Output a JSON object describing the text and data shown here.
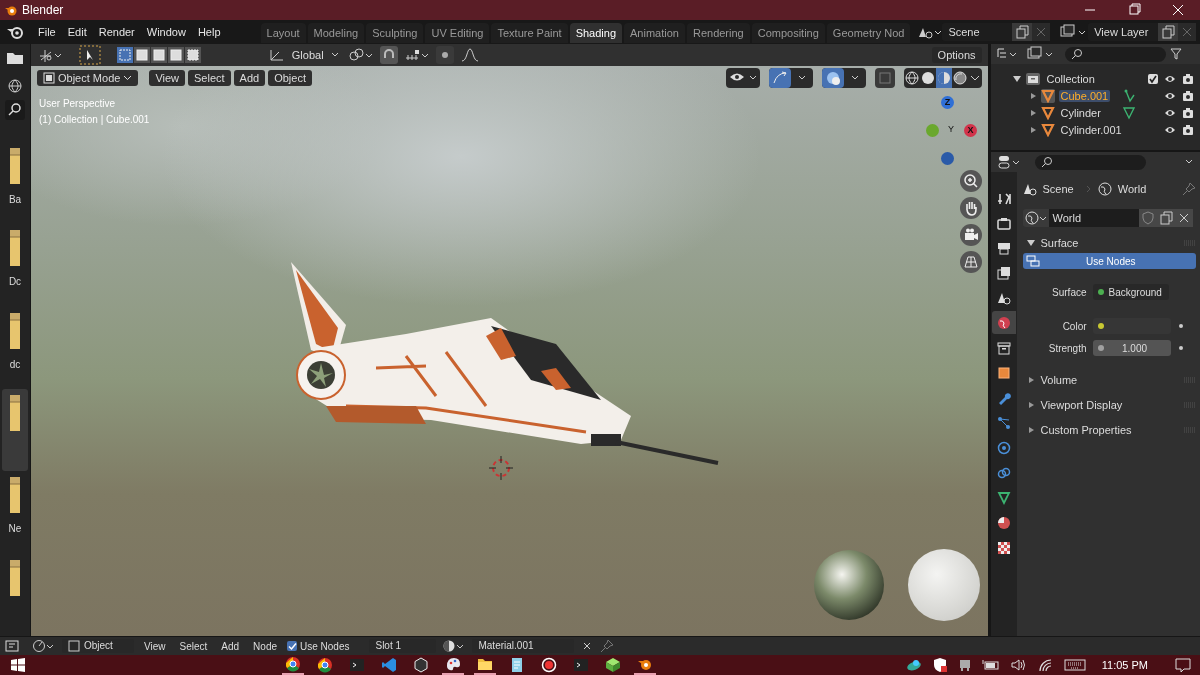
{
  "window": {
    "title": "Blender"
  },
  "menu": [
    "File",
    "Edit",
    "Render",
    "Window",
    "Help"
  ],
  "workspaces": [
    {
      "label": "Layout",
      "selected": false
    },
    {
      "label": "Modeling",
      "selected": false
    },
    {
      "label": "Sculpting",
      "selected": false
    },
    {
      "label": "UV Editing",
      "selected": false
    },
    {
      "label": "Texture Paint",
      "selected": false
    },
    {
      "label": "Shading",
      "selected": true
    },
    {
      "label": "Animation",
      "selected": false
    },
    {
      "label": "Rendering",
      "selected": false
    },
    {
      "label": "Compositing",
      "selected": false
    },
    {
      "label": "Geometry Nod",
      "selected": false
    }
  ],
  "scene": "Scene",
  "view_layer": "View Layer",
  "tool_header": {
    "select_modes": [
      {
        "selected": true
      },
      {
        "selected": false
      },
      {
        "selected": false
      },
      {
        "selected": false
      },
      {
        "selected": false
      }
    ],
    "orientation": "Global",
    "options": "Options"
  },
  "file_browser": {
    "items": [
      {
        "label": "Ba",
        "selected": false
      },
      {
        "label": "Dc",
        "selected": false
      },
      {
        "label": "dc",
        "selected": false
      },
      {
        "selected": true
      },
      {
        "label": "Ne",
        "selected": false
      },
      {
        "selected": false
      }
    ]
  },
  "viewport": {
    "mode": "Object Mode",
    "menus": [
      "View",
      "Select",
      "Add",
      "Object"
    ],
    "info": [
      "User Perspective",
      "(1) Collection | Cube.001"
    ],
    "shading": [
      {
        "kind": "wireframe",
        "selected": false
      },
      {
        "kind": "solid",
        "selected": false
      },
      {
        "kind": "material",
        "selected": true
      },
      {
        "kind": "rendered",
        "selected": false
      }
    ],
    "gizmo": {
      "x": "X",
      "y": "Y",
      "z": "Z"
    }
  },
  "outliner": {
    "items": [
      {
        "name": "Collection",
        "kind": "collection",
        "expanded": true,
        "checked": true,
        "children": [
          {
            "name": "Cube.001",
            "kind": "mesh",
            "expanded": false,
            "selected": true
          },
          {
            "name": "Cylinder",
            "kind": "mesh",
            "expanded": false,
            "selected": false
          },
          {
            "name": "Cylinder.001",
            "kind": "mesh",
            "expanded": false,
            "selected": false
          }
        ]
      }
    ]
  },
  "properties": {
    "tabs": [
      {
        "kind": "tool",
        "selected": false
      },
      {
        "kind": "render",
        "selected": false
      },
      {
        "kind": "output",
        "selected": false
      },
      {
        "kind": "view_layer",
        "selected": false
      },
      {
        "kind": "scene",
        "selected": false
      },
      {
        "kind": "world",
        "selected": true
      },
      {
        "kind": "collection",
        "selected": false
      },
      {
        "kind": "object",
        "selected": false
      },
      {
        "kind": "modifier",
        "selected": false
      },
      {
        "kind": "particles",
        "selected": false
      },
      {
        "kind": "physics",
        "selected": false
      },
      {
        "kind": "constraints",
        "selected": false
      },
      {
        "kind": "data",
        "selected": false
      },
      {
        "kind": "material",
        "selected": false
      },
      {
        "kind": "texture",
        "selected": false
      }
    ],
    "breadcrumb": [
      "Scene",
      "World"
    ],
    "world_name": "World",
    "panels": [
      {
        "title": "Surface",
        "expanded": true,
        "button": "Use Nodes",
        "rows": [
          {
            "label": "Surface",
            "value": "Background",
            "color": "#4caf50",
            "kind": "link"
          },
          {
            "label": "Color",
            "color": "#c8c832",
            "kind": "color"
          },
          {
            "label": "Strength",
            "value": "1.000",
            "color": "#a0a0a0",
            "kind": "number"
          }
        ]
      },
      {
        "title": "Volume",
        "expanded": false
      },
      {
        "title": "Viewport Display",
        "expanded": false
      },
      {
        "title": "Custom Properties",
        "expanded": false
      }
    ]
  },
  "node_header": {
    "mode": "Object",
    "menus": [
      "View",
      "Select",
      "Add",
      "Node"
    ],
    "use_nodes": {
      "label": "Use Nodes",
      "checked": true
    },
    "slot": "Slot 1",
    "material": "Material.001"
  },
  "taskbar": {
    "apps": [
      {
        "kind": "chrome",
        "running": true
      },
      {
        "kind": "chrome",
        "running": false
      },
      {
        "kind": "terminal",
        "running": false
      },
      {
        "kind": "code",
        "running": false
      },
      {
        "kind": "cube",
        "running": false
      },
      {
        "kind": "paint",
        "running": true
      },
      {
        "kind": "folder",
        "running": true
      },
      {
        "kind": "notes",
        "running": false
      },
      {
        "kind": "record",
        "running": false
      },
      {
        "kind": "terminal",
        "running": false
      },
      {
        "kind": "gem",
        "running": false
      },
      {
        "kind": "blender",
        "running": true
      }
    ],
    "time": "11:05 PM"
  }
}
